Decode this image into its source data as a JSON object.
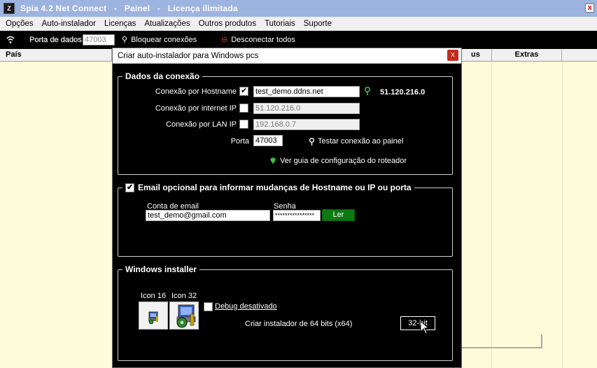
{
  "app": {
    "icon": "Z",
    "title": "Spia 4.2 Net Connect   -   Painel   -   Licença ilimitada",
    "close": "x"
  },
  "menu": [
    "Opções",
    "Auto-instalador",
    "Licenças",
    "Atualizações",
    "Outros produtos",
    "Tutoriais",
    "Suporte"
  ],
  "toolbar": {
    "port_label": "Porta de dados:",
    "port_value": "47003",
    "block_label": "Bloquear conexões",
    "disconnect_label": "Desconectar todos"
  },
  "grid": {
    "col_country": "País",
    "col_status_partial": "us",
    "col_extras": "Extras"
  },
  "dialog": {
    "title": "Criar auto-instalador para Windows pcs",
    "close": "x",
    "connection": {
      "legend": "Dados da conexão",
      "hostname_label": "Conexão por Hostname",
      "hostname_checked": true,
      "hostname_value": "test_demo.ddns.net",
      "resolved_ip": "51.120.216.0",
      "internet_label": "Conexão por internet IP",
      "internet_checked": false,
      "internet_value": "51.120.216.0",
      "lan_label": "Conexão por LAN IP",
      "lan_checked": false,
      "lan_value": "192.168.0.7",
      "port_label": "Porta",
      "port_value": "47003",
      "test_label": "Testar conexão ao painel",
      "guide_label": "Ver guia de configuração do roteador"
    },
    "email": {
      "legend": "Email opcional para informar mudanças de Hostname ou IP ou porta",
      "enabled": true,
      "account_label": "Conta de email",
      "account_value": "test_demo@gmail.com",
      "password_label": "Senha",
      "password_value": "****************",
      "read_button": "Ler"
    },
    "installer": {
      "legend": "Windows installer",
      "icon16_label": "Icon 16",
      "icon32_label": "Icon 32",
      "debug_label": "Debug desativado",
      "debug_checked": false,
      "build_label": "Criar instalador de 64 bits  (x64)",
      "bit_button": "32-bit"
    }
  },
  "colors": {
    "titlebar": "#9db3e0",
    "grid_bg": "#fdfbd9",
    "accent_green": "#0b7a12",
    "icon_green": "#39c43b",
    "close_red": "#c42b1c"
  }
}
